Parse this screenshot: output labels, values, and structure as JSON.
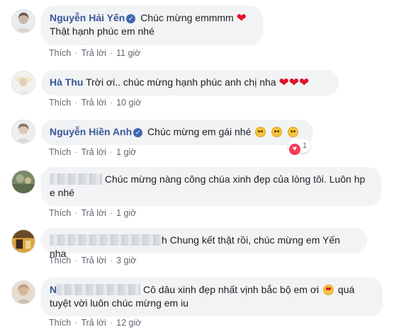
{
  "colors": {
    "name": "#385898",
    "bubble": "#f2f3f5",
    "heart": "#e0112b"
  },
  "comments": [
    {
      "name": "Nguyễn Hải Yến",
      "verified": true,
      "text_line1": "Chúc mừng emmmm",
      "text_line2": "Thật hạnh phúc em nhé",
      "like": "Thích",
      "reply": "Trả lời",
      "time": "11 giờ"
    },
    {
      "name": "Hà Thu",
      "text_line1": "Trời ơi.. chúc mừng hạnh phúc anh chị nha",
      "like": "Thích",
      "reply": "Trả lời",
      "time": "10 giờ"
    },
    {
      "name": "Nguyễn Hiền Anh",
      "verified": true,
      "text_line1": "Chúc mừng em gái nhé",
      "reaction_count": "1",
      "like": "Thích",
      "reply": "Trả lời",
      "time": "1 giờ"
    },
    {
      "text_line1": "Chúc mừng nàng công chúa xinh đẹp của lòng tôi. Luôn hp",
      "text_line2": "e nhé",
      "like": "Thích",
      "reply": "Trả lời",
      "time": "1 giờ"
    },
    {
      "name_visible": "h",
      "text_line1": "Chung kết thật rồi, chúc mừng em Yến nha",
      "like": "Thích",
      "reply": "Trả lời",
      "time": "3 giờ"
    },
    {
      "name_visible": "N",
      "text_line1": "Cô dâu xinh đẹp nhất vịnh bắc bộ em ơi",
      "text_line1_end": "quá",
      "text_line2": "tuyệt vời luôn chúc mừng em iu",
      "like": "Thích",
      "reply": "Trả lời",
      "time": "12 giờ"
    }
  ]
}
